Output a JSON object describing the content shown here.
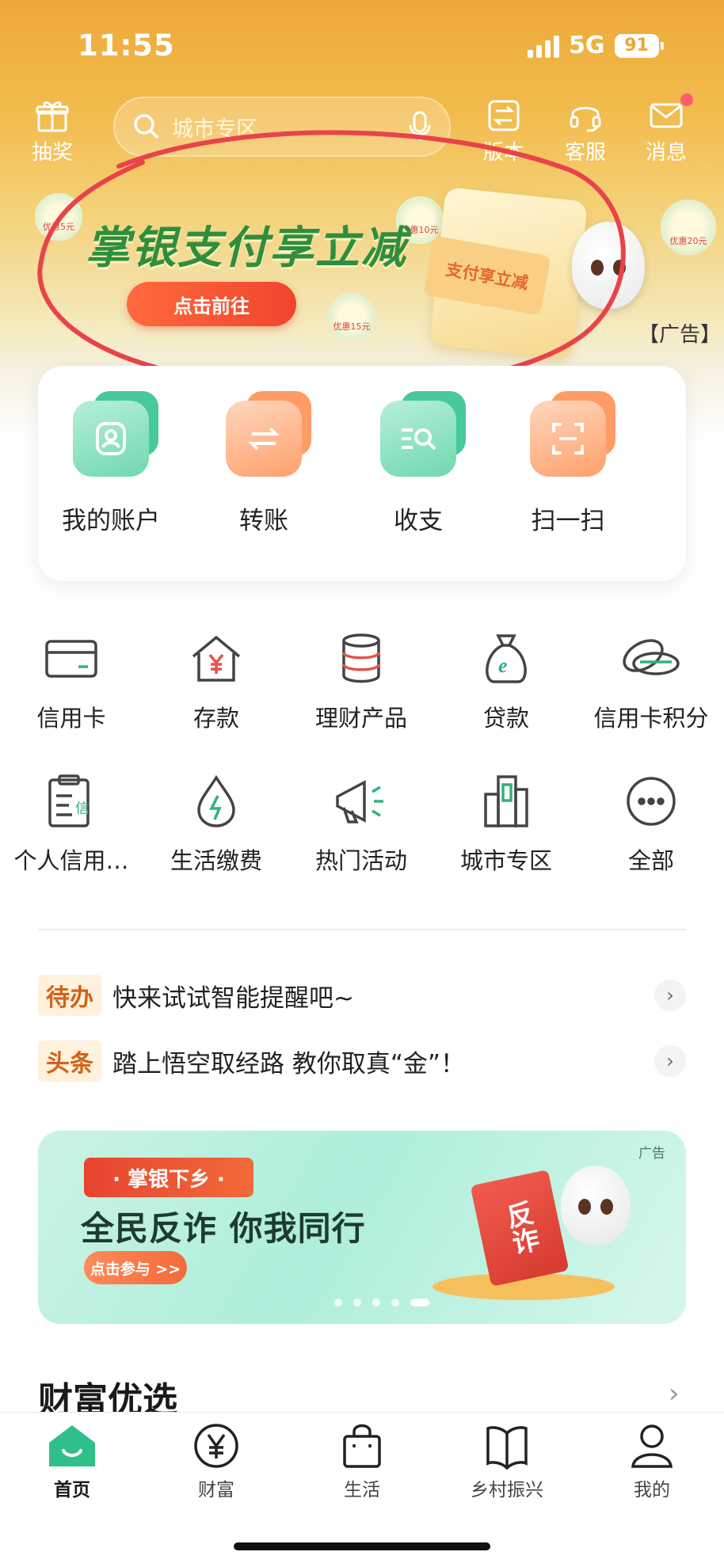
{
  "status_bar": {
    "time": "11:55",
    "network": "5G",
    "battery": "91"
  },
  "header": {
    "lottery_label": "抽奖",
    "search_placeholder": "城市专区",
    "version_label": "版本",
    "service_label": "客服",
    "message_label": "消息"
  },
  "ad_banner": {
    "title": "掌银支付享立减",
    "button": "点击前往",
    "ticket_text": "支付享立减",
    "ad_tag": "【广告】",
    "coins": [
      "优惠5元",
      "优惠10元",
      "优惠15元",
      "优惠20元"
    ]
  },
  "quick_actions": [
    {
      "label": "我的账户",
      "icon": "user-icon",
      "color": "green"
    },
    {
      "label": "转账",
      "icon": "transfer-icon",
      "color": "orange"
    },
    {
      "label": "收支",
      "icon": "search-list-icon",
      "color": "green"
    },
    {
      "label": "扫一扫",
      "icon": "scan-icon",
      "color": "orange"
    }
  ],
  "services": [
    {
      "label": "信用卡",
      "icon": "card-icon"
    },
    {
      "label": "存款",
      "icon": "house-yen-icon"
    },
    {
      "label": "理财产品",
      "icon": "coin-stack-icon"
    },
    {
      "label": "贷款",
      "icon": "money-bag-icon"
    },
    {
      "label": "信用卡积分",
      "icon": "points-icon"
    },
    {
      "label": "个人信用…",
      "icon": "clipboard-icon"
    },
    {
      "label": "生活缴费",
      "icon": "water-drop-icon"
    },
    {
      "label": "热门活动",
      "icon": "megaphone-icon"
    },
    {
      "label": "城市专区",
      "icon": "buildings-icon"
    },
    {
      "label": "全部",
      "icon": "more-icon"
    }
  ],
  "clipboard_badge": "信",
  "notices": [
    {
      "tag": "待办",
      "text": "快来试试智能提醒吧~"
    },
    {
      "tag": "头条",
      "text": "踏上悟空取经路 教你取真“金”！"
    }
  ],
  "promo_banner": {
    "ribbon": "· 掌银下乡 ·",
    "title": "全民反诈 你我同行",
    "button": "点击参与 >>",
    "ad_tag": "广告",
    "book_text": "反诈",
    "slide_count": 5,
    "active_slide": 5
  },
  "section": {
    "title": "财富优选"
  },
  "tabbar": [
    {
      "label": "首页",
      "icon": "home-icon",
      "active": true
    },
    {
      "label": "财富",
      "icon": "yen-icon",
      "active": false
    },
    {
      "label": "生活",
      "icon": "bag-icon",
      "active": false
    },
    {
      "label": "乡村振兴",
      "icon": "book-icon",
      "active": false
    },
    {
      "label": "我的",
      "icon": "person-icon",
      "active": false
    }
  ],
  "colors": {
    "brand_green": "#2f9e5e",
    "header_orange": "#eca93a",
    "accent_red": "#f0452e"
  }
}
